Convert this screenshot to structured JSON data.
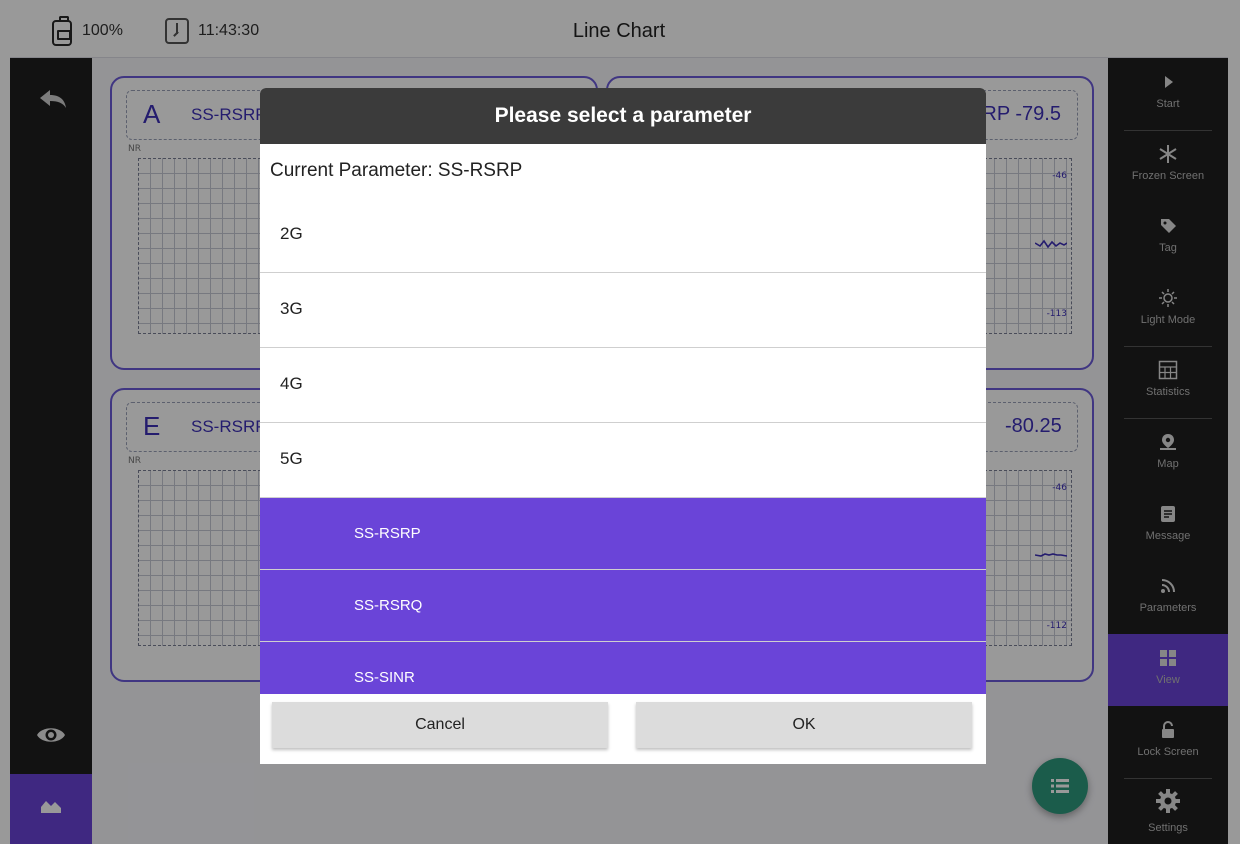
{
  "topbar": {
    "battery": "100%",
    "time": "11:43:30",
    "title": "Line Chart"
  },
  "panels": [
    {
      "letter": "A",
      "param": "SS-RSRP",
      "value": "RP  -79.5",
      "nr": "NR",
      "ticks": [
        "-46",
        "-113"
      ]
    },
    {
      "letter": "E",
      "param": "SS-RSRP",
      "value": "-80.25",
      "nr": "NR",
      "ticks": [
        "-46",
        "-112"
      ]
    }
  ],
  "right_rail": {
    "items": [
      {
        "label": "Start",
        "icon": "play-icon"
      },
      {
        "label": "Frozen Screen",
        "icon": "snowflake-icon"
      },
      {
        "label": "Tag",
        "icon": "tag-icon"
      },
      {
        "label": "Light Mode",
        "icon": "sun-icon"
      },
      {
        "label": "Statistics",
        "icon": "table-icon"
      },
      {
        "label": "Map",
        "icon": "map-pin-icon"
      },
      {
        "label": "Message",
        "icon": "message-icon"
      },
      {
        "label": "Parameters",
        "icon": "parameters-icon"
      },
      {
        "label": "View",
        "icon": "grid-icon",
        "selected": true
      },
      {
        "label": "Lock Screen",
        "icon": "lock-icon"
      },
      {
        "label": "Settings",
        "icon": "gear-icon"
      }
    ]
  },
  "dialog": {
    "title": "Please select a parameter",
    "current": "Current Parameter: SS-RSRP",
    "groups": [
      "2G",
      "3G",
      "4G",
      "5G"
    ],
    "sub_options": [
      "SS-RSRP",
      "SS-RSRQ",
      "SS-SINR"
    ],
    "cancel_label": "Cancel",
    "ok_label": "OK"
  },
  "colors": {
    "accent": "#6a44d8",
    "rail": "#1e1e1e",
    "panel_text": "#3d2fb8",
    "fab": "#2e9a7d",
    "dialog_title_bg": "#3b3b3b"
  }
}
